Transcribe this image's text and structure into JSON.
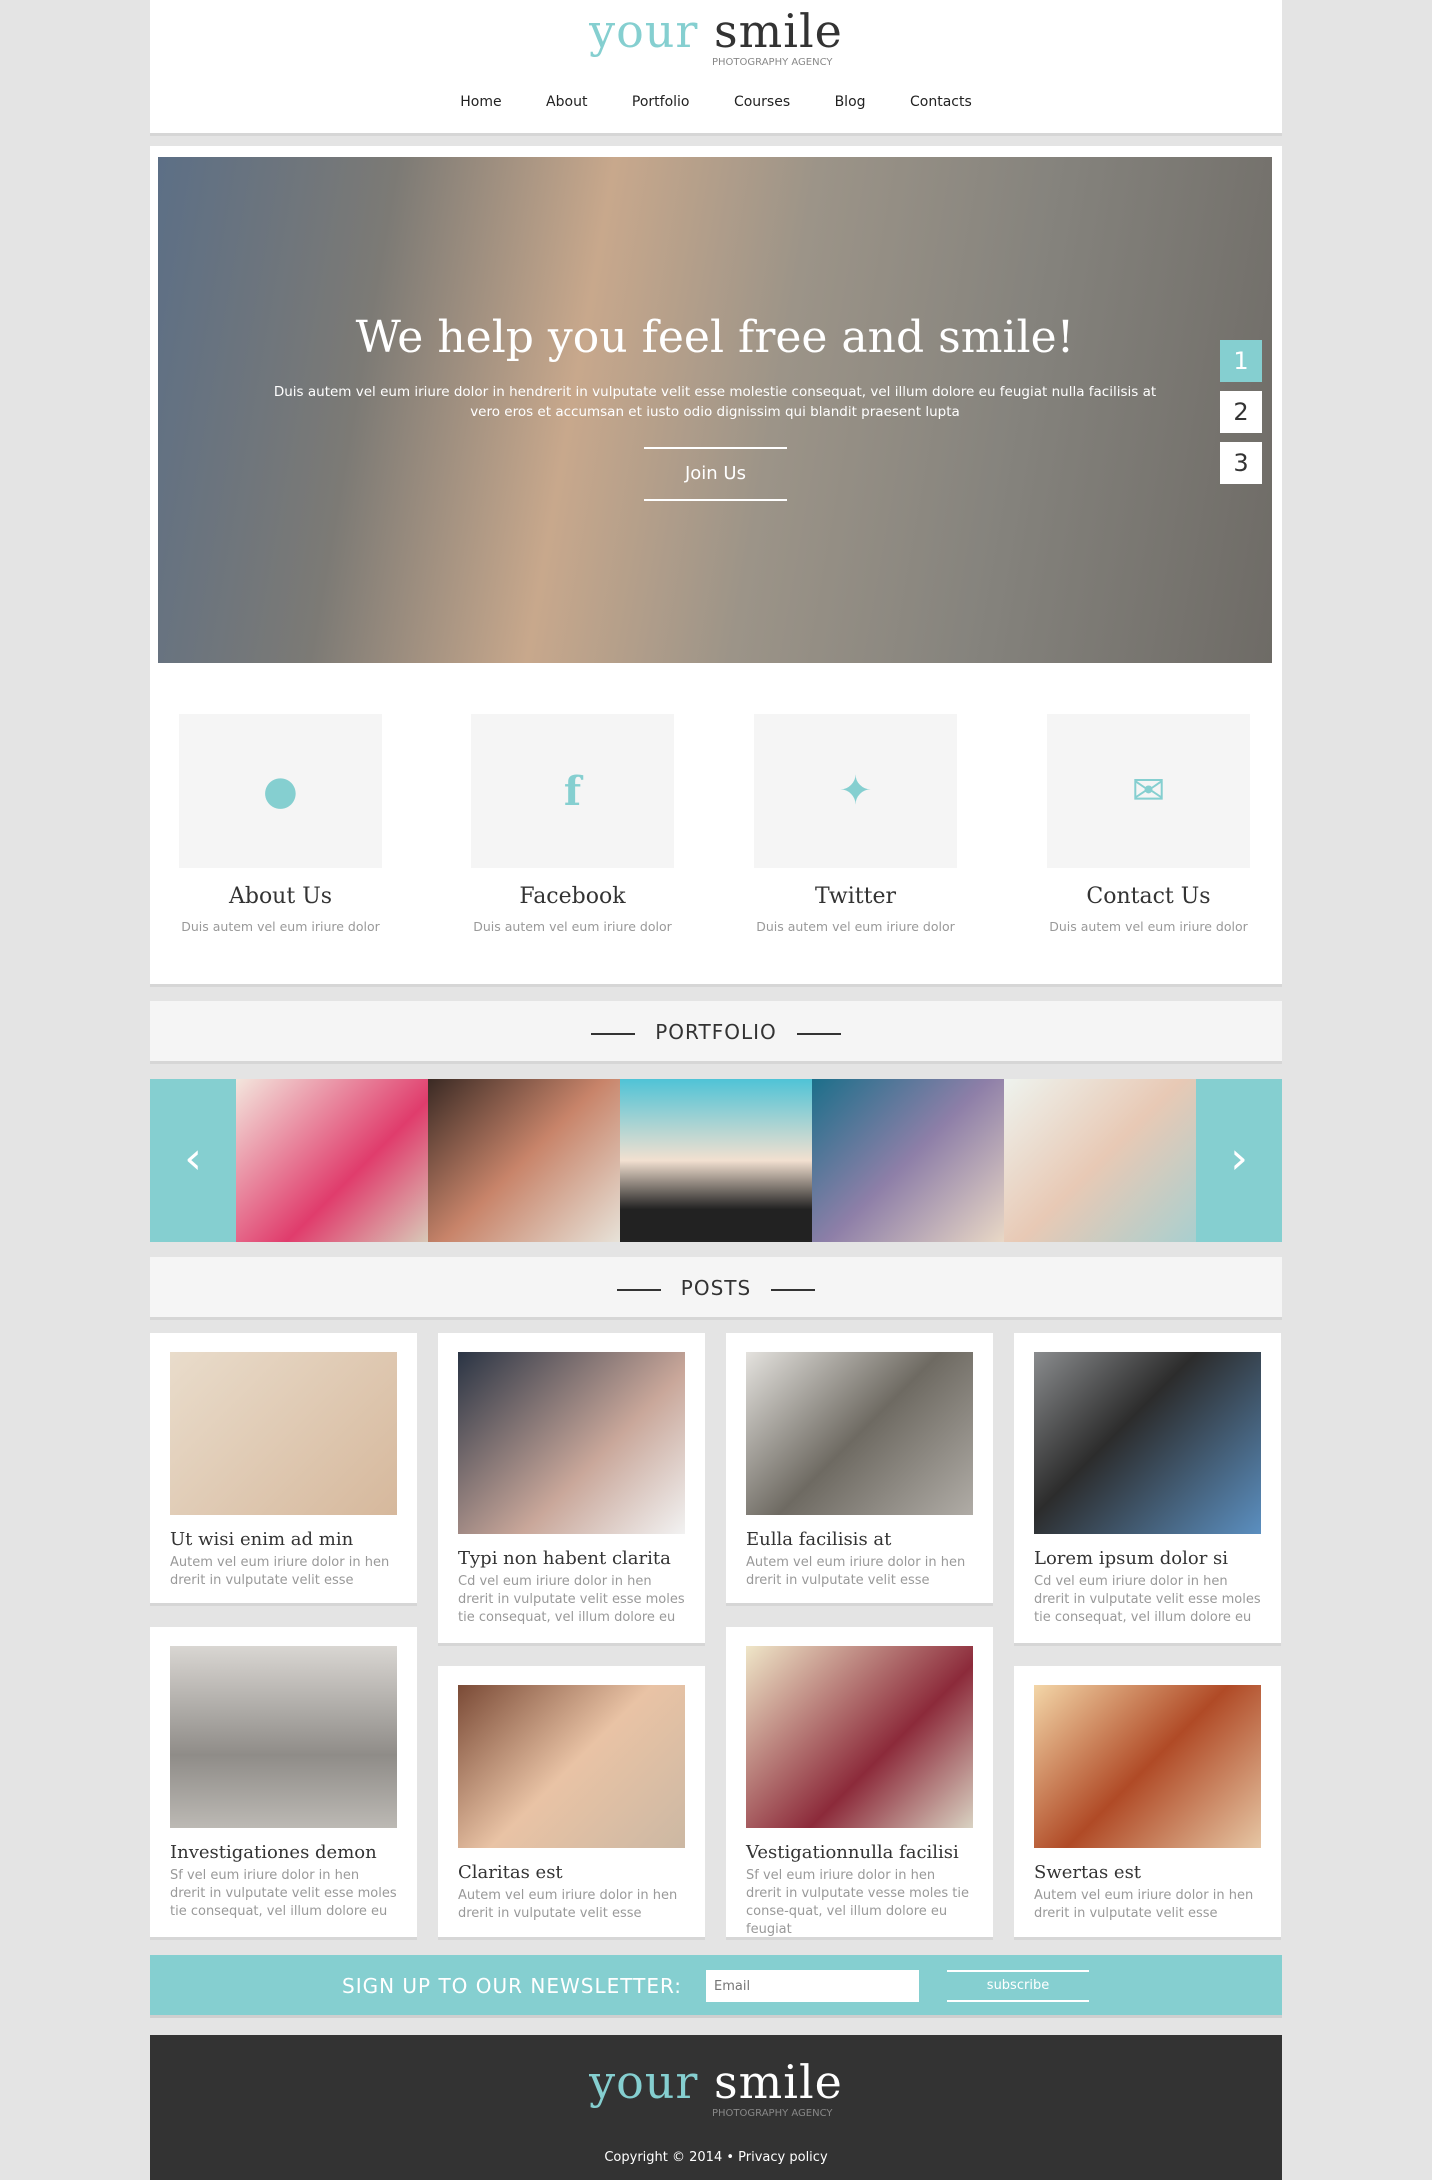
{
  "brand": {
    "word1": "your",
    "word2": "smile",
    "tagline": "PHOTOGRAPHY AGENCY",
    "accent": "#85cfd0"
  },
  "nav": [
    "Home",
    "About",
    "Portfolio",
    "Courses",
    "Blog",
    "Contacts"
  ],
  "hero": {
    "title": "We help you feel free and smile!",
    "text": "Duis autem vel eum iriure dolor in hendrerit in vulputate velit esse molestie consequat, vel illum dolore eu feugiat nulla facilisis at vero eros et accumsan et iusto odio dignissim qui blandit praesent lupta",
    "button": "Join Us",
    "slides": [
      "1",
      "2",
      "3"
    ],
    "active_slide": 1
  },
  "features": [
    {
      "icon": "camera-icon",
      "title": "About Us",
      "text": "Duis autem vel eum iriure dolor"
    },
    {
      "icon": "facebook-icon",
      "title": "Facebook",
      "text": "Duis autem vel eum iriure dolor"
    },
    {
      "icon": "twitter-icon",
      "title": "Twitter",
      "text": "Duis autem vel eum iriure dolor"
    },
    {
      "icon": "envelope-icon",
      "title": "Contact Us",
      "text": "Duis autem vel eum iriure dolor"
    }
  ],
  "portfolio": {
    "title": "PORTFOLIO"
  },
  "posts_title": "POSTS",
  "posts": [
    {
      "title": "Ut wisi enim ad min",
      "text": "Autem vel eum iriure dolor in hen drerit in vulputate velit esse"
    },
    {
      "title": "Typi non habent clarita",
      "text": "Cd vel eum iriure dolor in hen drerit in vulputate velit esse moles tie consequat, vel illum dolore eu"
    },
    {
      "title": "Eulla facilisis at",
      "text": "Autem vel eum iriure dolor in hen drerit in vulputate velit esse"
    },
    {
      "title": "Lorem ipsum dolor si",
      "text": "Cd vel eum iriure dolor in hen drerit in vulputate velit esse moles tie consequat, vel illum dolore eu"
    },
    {
      "title": "Investigationes demon",
      "text": "Sf vel eum iriure dolor in hen drerit in vulputate velit esse moles tie consequat, vel illum dolore eu"
    },
    {
      "title": "Claritas est",
      "text": "Autem vel eum iriure dolor in hen drerit in vulputate velit esse"
    },
    {
      "title": "Vestigationnulla facilisi",
      "text": "Sf vel eum iriure dolor in hen drerit in vulputate vesse moles tie conse-quat, vel illum dolore eu feugiat"
    },
    {
      "title": "Swertas est",
      "text": "Autem vel eum iriure dolor in hen drerit in vulputate velit esse"
    }
  ],
  "newsletter": {
    "label": "SIGN UP TO OUR NEWSLETTER:",
    "placeholder": "Email",
    "button": "subscribe"
  },
  "footer": {
    "copyright": "Copyright © 2014 • Privacy policy"
  }
}
